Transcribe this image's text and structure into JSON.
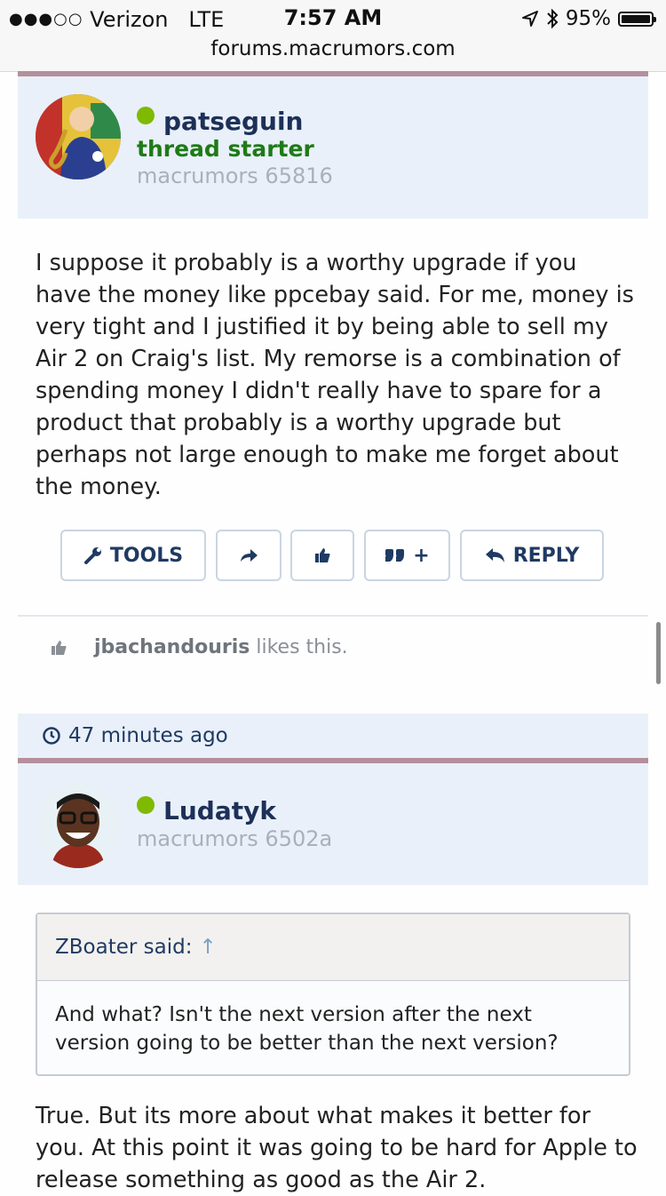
{
  "status": {
    "carrier": "Verizon",
    "network": "LTE",
    "time": "7:57 AM",
    "battery": "95%"
  },
  "browser": {
    "url": "forums.macrumors.com"
  },
  "post1": {
    "username": "patseguin",
    "badge": "thread starter",
    "user_title": "macrumors 65816",
    "body": "I suppose it probably is a worthy upgrade if you have the money like ppcebay said. For me, money is very tight and I justified it by being able to sell my Air 2 on Craig's list. My remorse is a combination of spending money I didn't really have to spare for a product that probably is a worthy upgrade but perhaps not large enough to make me forget about the money.",
    "actions": {
      "tools": "TOOLS",
      "quote": "+",
      "reply": "REPLY"
    },
    "likes": {
      "user": "jbachandouris",
      "text": " likes this."
    }
  },
  "post2": {
    "timestamp": "47 minutes ago",
    "username": "Ludatyk",
    "user_title": "macrumors 6502a",
    "quote": {
      "author": "ZBoater said:",
      "arrow": "↑",
      "text": "And what? Isn't the next version after the next version going to be better than the next version?"
    },
    "body": "True. But its more about what makes it better for you. At this point it was going to be hard for Apple to release something as good as the Air 2."
  },
  "colors": {
    "accent_navy": "#1f3a63",
    "online_green": "#7fba00",
    "starter_green": "#1e7a17",
    "header_bg": "#e9f0f9",
    "divider_pink": "#b58f9b"
  }
}
